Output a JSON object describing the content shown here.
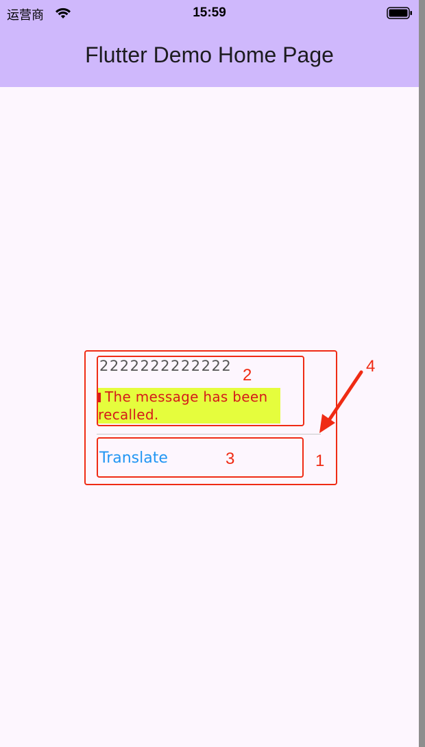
{
  "status_bar": {
    "carrier": "运营商",
    "time": "15:59",
    "icons": [
      "wifi-icon",
      "battery-icon"
    ]
  },
  "app_bar": {
    "title": "Flutter Demo Home Page"
  },
  "message": {
    "original_text": "2222222222222",
    "recalled_text": "The message has been recalled.",
    "translate_label": "Translate"
  },
  "annotations": {
    "labels": [
      "1",
      "2",
      "3",
      "4"
    ],
    "color": "#ef2b14"
  },
  "colors": {
    "app_bar_bg": "#cfb8fc",
    "page_bg": "#fdf6fe",
    "highlight_bg": "#e5fd3d",
    "recalled_text": "#d41a1a",
    "link": "#2196f3"
  }
}
